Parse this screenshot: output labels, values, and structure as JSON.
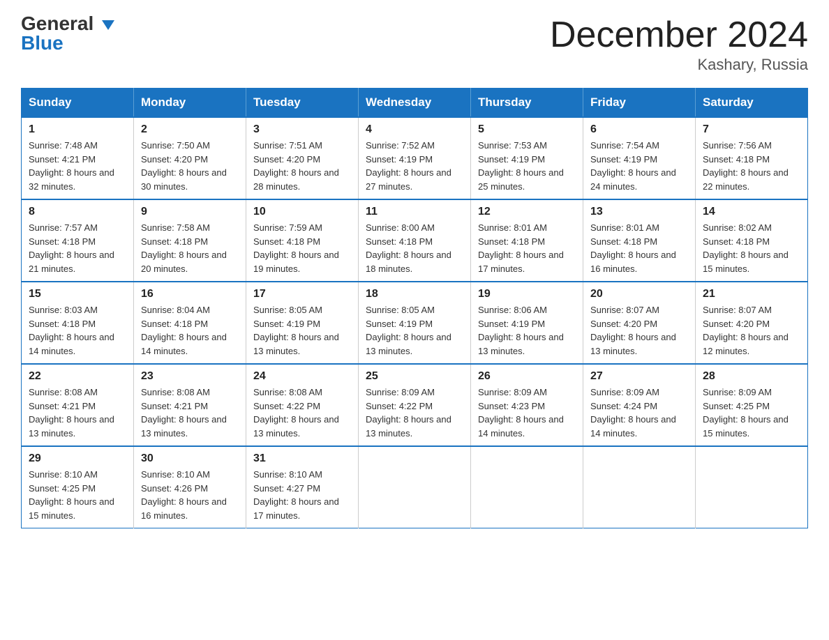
{
  "logo": {
    "part1": "General",
    "part2": "Blue"
  },
  "title": "December 2024",
  "subtitle": "Kashary, Russia",
  "days_of_week": [
    "Sunday",
    "Monday",
    "Tuesday",
    "Wednesday",
    "Thursday",
    "Friday",
    "Saturday"
  ],
  "weeks": [
    [
      {
        "day": "1",
        "sunrise": "7:48 AM",
        "sunset": "4:21 PM",
        "daylight": "8 hours and 32 minutes."
      },
      {
        "day": "2",
        "sunrise": "7:50 AM",
        "sunset": "4:20 PM",
        "daylight": "8 hours and 30 minutes."
      },
      {
        "day": "3",
        "sunrise": "7:51 AM",
        "sunset": "4:20 PM",
        "daylight": "8 hours and 28 minutes."
      },
      {
        "day": "4",
        "sunrise": "7:52 AM",
        "sunset": "4:19 PM",
        "daylight": "8 hours and 27 minutes."
      },
      {
        "day": "5",
        "sunrise": "7:53 AM",
        "sunset": "4:19 PM",
        "daylight": "8 hours and 25 minutes."
      },
      {
        "day": "6",
        "sunrise": "7:54 AM",
        "sunset": "4:19 PM",
        "daylight": "8 hours and 24 minutes."
      },
      {
        "day": "7",
        "sunrise": "7:56 AM",
        "sunset": "4:18 PM",
        "daylight": "8 hours and 22 minutes."
      }
    ],
    [
      {
        "day": "8",
        "sunrise": "7:57 AM",
        "sunset": "4:18 PM",
        "daylight": "8 hours and 21 minutes."
      },
      {
        "day": "9",
        "sunrise": "7:58 AM",
        "sunset": "4:18 PM",
        "daylight": "8 hours and 20 minutes."
      },
      {
        "day": "10",
        "sunrise": "7:59 AM",
        "sunset": "4:18 PM",
        "daylight": "8 hours and 19 minutes."
      },
      {
        "day": "11",
        "sunrise": "8:00 AM",
        "sunset": "4:18 PM",
        "daylight": "8 hours and 18 minutes."
      },
      {
        "day": "12",
        "sunrise": "8:01 AM",
        "sunset": "4:18 PM",
        "daylight": "8 hours and 17 minutes."
      },
      {
        "day": "13",
        "sunrise": "8:01 AM",
        "sunset": "4:18 PM",
        "daylight": "8 hours and 16 minutes."
      },
      {
        "day": "14",
        "sunrise": "8:02 AM",
        "sunset": "4:18 PM",
        "daylight": "8 hours and 15 minutes."
      }
    ],
    [
      {
        "day": "15",
        "sunrise": "8:03 AM",
        "sunset": "4:18 PM",
        "daylight": "8 hours and 14 minutes."
      },
      {
        "day": "16",
        "sunrise": "8:04 AM",
        "sunset": "4:18 PM",
        "daylight": "8 hours and 14 minutes."
      },
      {
        "day": "17",
        "sunrise": "8:05 AM",
        "sunset": "4:19 PM",
        "daylight": "8 hours and 13 minutes."
      },
      {
        "day": "18",
        "sunrise": "8:05 AM",
        "sunset": "4:19 PM",
        "daylight": "8 hours and 13 minutes."
      },
      {
        "day": "19",
        "sunrise": "8:06 AM",
        "sunset": "4:19 PM",
        "daylight": "8 hours and 13 minutes."
      },
      {
        "day": "20",
        "sunrise": "8:07 AM",
        "sunset": "4:20 PM",
        "daylight": "8 hours and 13 minutes."
      },
      {
        "day": "21",
        "sunrise": "8:07 AM",
        "sunset": "4:20 PM",
        "daylight": "8 hours and 12 minutes."
      }
    ],
    [
      {
        "day": "22",
        "sunrise": "8:08 AM",
        "sunset": "4:21 PM",
        "daylight": "8 hours and 13 minutes."
      },
      {
        "day": "23",
        "sunrise": "8:08 AM",
        "sunset": "4:21 PM",
        "daylight": "8 hours and 13 minutes."
      },
      {
        "day": "24",
        "sunrise": "8:08 AM",
        "sunset": "4:22 PM",
        "daylight": "8 hours and 13 minutes."
      },
      {
        "day": "25",
        "sunrise": "8:09 AM",
        "sunset": "4:22 PM",
        "daylight": "8 hours and 13 minutes."
      },
      {
        "day": "26",
        "sunrise": "8:09 AM",
        "sunset": "4:23 PM",
        "daylight": "8 hours and 14 minutes."
      },
      {
        "day": "27",
        "sunrise": "8:09 AM",
        "sunset": "4:24 PM",
        "daylight": "8 hours and 14 minutes."
      },
      {
        "day": "28",
        "sunrise": "8:09 AM",
        "sunset": "4:25 PM",
        "daylight": "8 hours and 15 minutes."
      }
    ],
    [
      {
        "day": "29",
        "sunrise": "8:10 AM",
        "sunset": "4:25 PM",
        "daylight": "8 hours and 15 minutes."
      },
      {
        "day": "30",
        "sunrise": "8:10 AM",
        "sunset": "4:26 PM",
        "daylight": "8 hours and 16 minutes."
      },
      {
        "day": "31",
        "sunrise": "8:10 AM",
        "sunset": "4:27 PM",
        "daylight": "8 hours and 17 minutes."
      },
      null,
      null,
      null,
      null
    ]
  ]
}
